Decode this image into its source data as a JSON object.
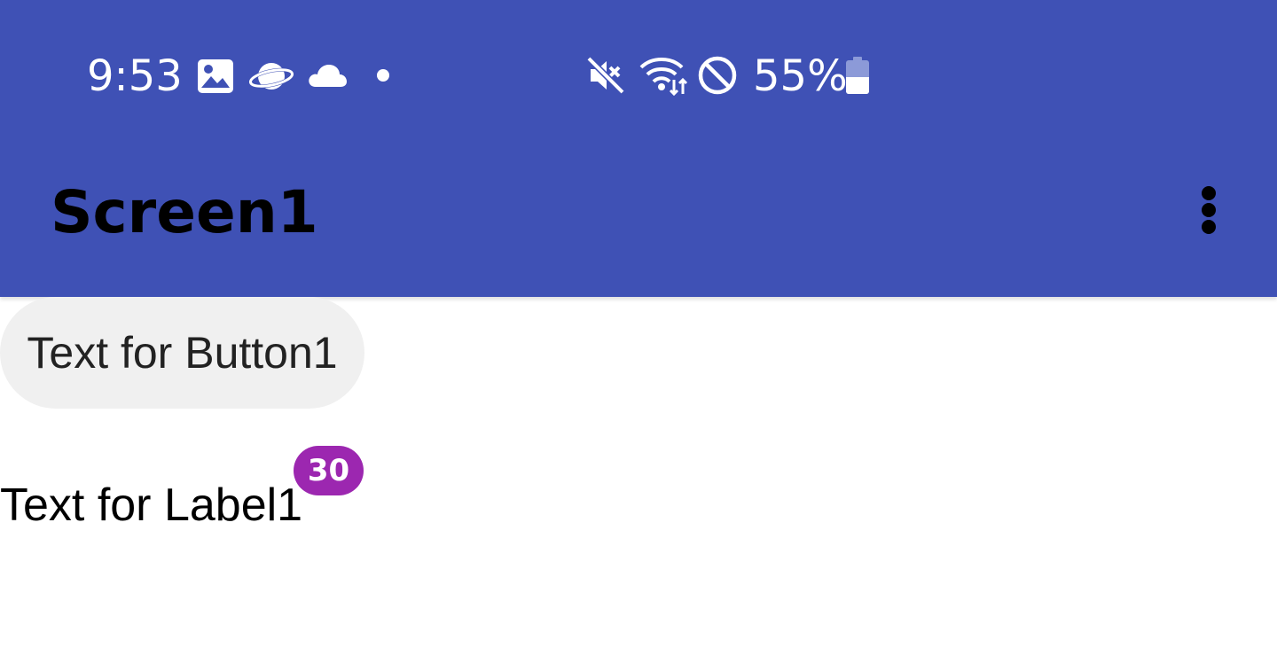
{
  "status_bar": {
    "time": "9:53",
    "battery_percent": "55%",
    "battery_level": 0.55,
    "left_icons": [
      "image-icon",
      "planet-icon",
      "cloud-icon",
      "dot-icon"
    ],
    "right_icons": [
      "mute-icon",
      "wifi-icon",
      "block-icon",
      "battery-icon"
    ]
  },
  "app_bar": {
    "title": "Screen1",
    "menu_icon": "more-vertical-icon"
  },
  "content": {
    "button1_label": "Text for Button1",
    "label1_text": "Text for Label1",
    "badge_count": "30"
  },
  "colors": {
    "primary": "#3F51B5",
    "badge": "#9C27B0",
    "button_bg": "#F0F0F0"
  }
}
